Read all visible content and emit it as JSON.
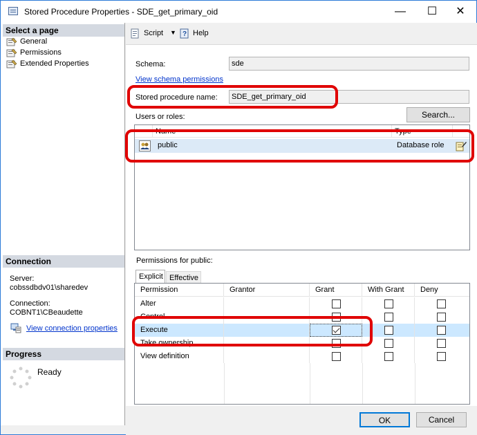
{
  "window": {
    "title": "Stored Procedure Properties - SDE_get_primary_oid",
    "minimize_glyph": "—",
    "maximize_glyph": "☐",
    "close_glyph": "✕"
  },
  "left_panel": {
    "select_page_header": "Select a page",
    "pages": [
      {
        "label": "General",
        "icon": "wrench-page-icon"
      },
      {
        "label": "Permissions",
        "icon": "wrench-page-icon"
      },
      {
        "label": "Extended Properties",
        "icon": "wrench-page-icon"
      }
    ],
    "connection_header": "Connection",
    "server_label": "Server:",
    "server_value": "cobssdbdv01\\sharedev",
    "connection_label": "Connection:",
    "connection_value": "COBNT1\\CBeaudette",
    "view_connection_link": "View connection properties",
    "progress_header": "Progress",
    "progress_status": "Ready"
  },
  "toolbar": {
    "script_label": "Script",
    "help_label": "Help"
  },
  "main": {
    "schema_label": "Schema:",
    "schema_value": "sde",
    "view_schema_link": "View schema permissions",
    "proc_name_label": "Stored procedure name:",
    "proc_name_value": "SDE_get_primary_oid",
    "users_roles_label": "Users or roles:",
    "search_button": "Search...",
    "users_columns": [
      "Name",
      "Type"
    ],
    "users": [
      {
        "name": "public",
        "type": "Database role"
      }
    ],
    "permissions_label": "Permissions for public:",
    "tabs": [
      "Explicit",
      "Effective"
    ],
    "active_tab": "Explicit",
    "perm_columns": [
      "Permission",
      "Grantor",
      "Grant",
      "With Grant",
      "Deny"
    ],
    "permissions": [
      {
        "name": "Alter",
        "grantor": "",
        "grant": false,
        "with_grant": false,
        "deny": false
      },
      {
        "name": "Control",
        "grantor": "",
        "grant": false,
        "with_grant": false,
        "deny": false
      },
      {
        "name": "Execute",
        "grantor": "",
        "grant": true,
        "with_grant": false,
        "deny": false
      },
      {
        "name": "Take ownership",
        "grantor": "",
        "grant": false,
        "with_grant": false,
        "deny": false
      },
      {
        "name": "View definition",
        "grantor": "",
        "grant": false,
        "with_grant": false,
        "deny": false
      }
    ]
  },
  "footer": {
    "ok_label": "OK",
    "cancel_label": "Cancel"
  },
  "colors": {
    "annotation_red": "#e00000",
    "selection_blue": "#cce8ff",
    "section_header": "#d4d9e1",
    "link_blue": "#0033cc"
  }
}
